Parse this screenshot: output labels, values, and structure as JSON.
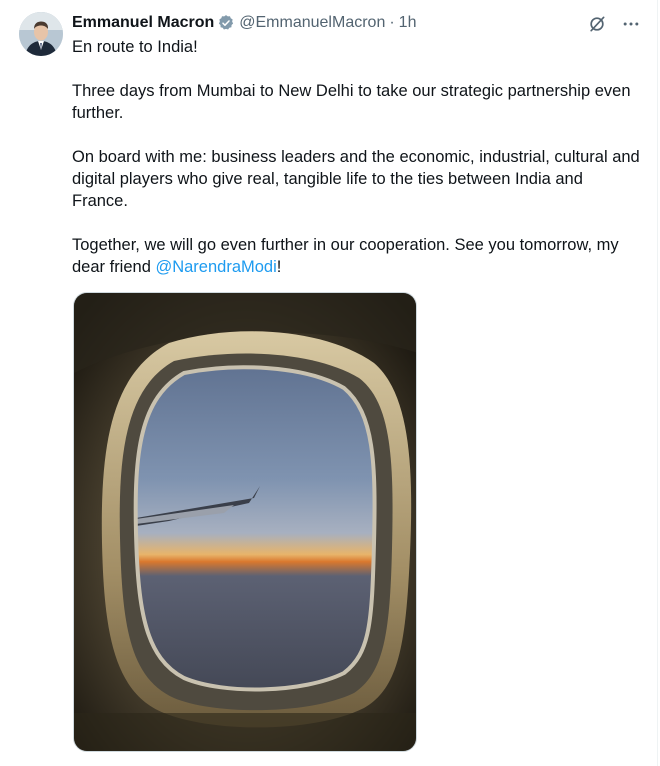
{
  "author": {
    "name": "Emmanuel Macron",
    "handle": "@EmmanuelMacron",
    "separator": "·",
    "time": "1h"
  },
  "tweet": {
    "line1": "En route to India!",
    "para2": "Three days from Mumbai to New Delhi to take our strategic partnership even further.",
    "para3": "On board with me: business leaders and the economic, industrial, cultural and digital players who give real, tangible life to the ties between India and France.",
    "para4_text": "Together, we will go even further in our cooperation. See you tomorrow, my dear friend ",
    "para4_mention": "@NarendraModi",
    "para4_end": "!"
  },
  "icons": {
    "verified": "verified-badge-icon",
    "grok": "grok-icon",
    "more": "more-icon"
  },
  "colors": {
    "accent": "#1d9bf0",
    "text": "#0f1419",
    "secondary": "#536471",
    "verified_badge": "#829aab"
  }
}
